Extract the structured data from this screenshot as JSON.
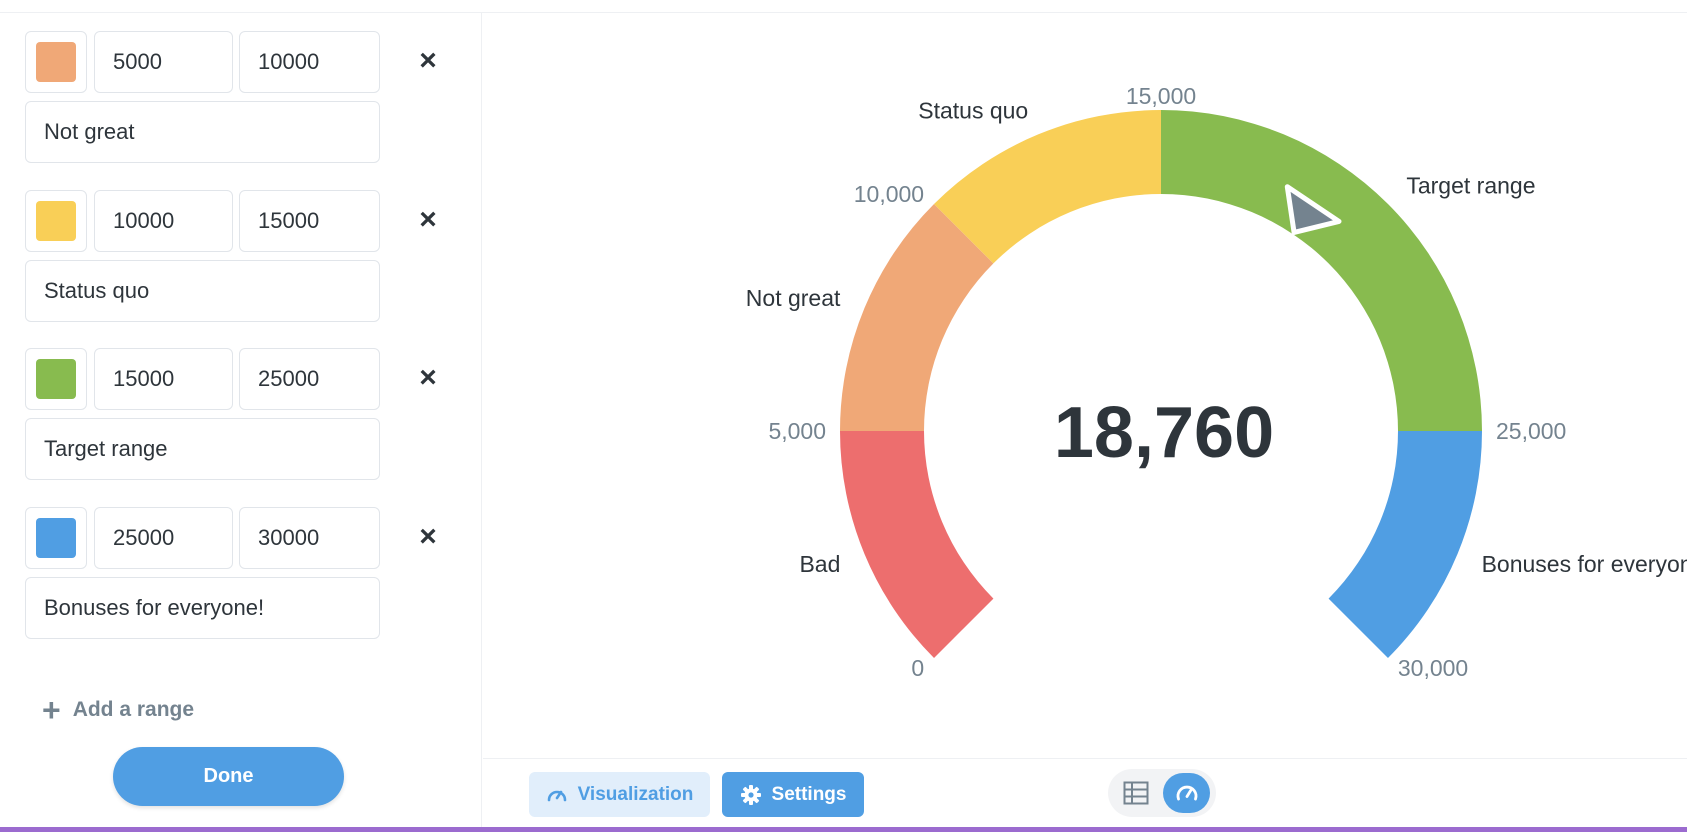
{
  "ranges": [
    {
      "color": "#f0a877",
      "min": "5000",
      "max": "10000",
      "label": "Not great"
    },
    {
      "color": "#f9cf57",
      "min": "10000",
      "max": "15000",
      "label": "Status quo"
    },
    {
      "color": "#88bb4f",
      "min": "15000",
      "max": "25000",
      "label": "Target range"
    },
    {
      "color": "#509ee3",
      "min": "25000",
      "max": "30000",
      "label": "Bonuses for everyone!"
    }
  ],
  "remove_icon": "×",
  "add_range_label": "Add a range",
  "done_label": "Done",
  "gauge": {
    "value": 18760,
    "value_display": "18,760",
    "min": 0,
    "max": 30000,
    "needle_color": "#74838f",
    "segments": [
      {
        "from": 0,
        "to": 5000,
        "color": "#ed6e6e",
        "label": "Bad"
      },
      {
        "from": 5000,
        "to": 10000,
        "color": "#f0a877",
        "label": "Not great"
      },
      {
        "from": 10000,
        "to": 15000,
        "color": "#f9cf57",
        "label": "Status quo"
      },
      {
        "from": 15000,
        "to": 25000,
        "color": "#88bb4f",
        "label": "Target range"
      },
      {
        "from": 25000,
        "to": 30000,
        "color": "#509ee3",
        "label": "Bonuses for everyone!"
      }
    ],
    "ticks": [
      {
        "value": 0,
        "label": "0"
      },
      {
        "value": 5000,
        "label": "5,000"
      },
      {
        "value": 10000,
        "label": "10,000"
      },
      {
        "value": 15000,
        "label": "15,000"
      },
      {
        "value": 25000,
        "label": "25,000"
      },
      {
        "value": 30000,
        "label": "30,000"
      }
    ]
  },
  "bottom_bar": {
    "visualization_label": "Visualization",
    "settings_label": "Settings",
    "visualization_icon": "gauge-icon",
    "settings_icon": "gear-icon",
    "table_toggle_icon": "table-icon",
    "gauge_toggle_icon": "gauge-icon"
  },
  "accent_color": "#509ee3"
}
